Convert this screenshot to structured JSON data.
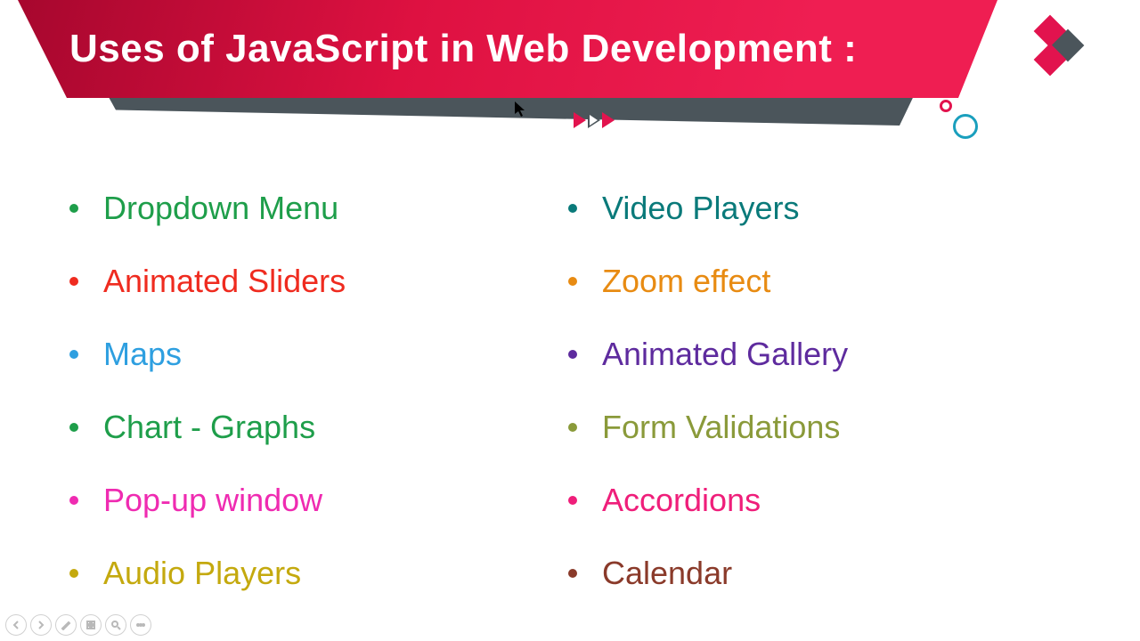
{
  "title": "Uses of JavaScript in Web Development :",
  "left_items": [
    {
      "label": "Dropdown Menu",
      "color": "#1e9e4a"
    },
    {
      "label": "Animated Sliders",
      "color": "#ef2b1f"
    },
    {
      "label": "Maps",
      "color": "#2e9fe0"
    },
    {
      "label": "Chart - Graphs",
      "color": "#1e9e4a"
    },
    {
      "label": "Pop-up window",
      "color": "#ef2bb1"
    },
    {
      "label": "Audio Players",
      "color": "#c4a90e"
    }
  ],
  "right_items": [
    {
      "label": "Video Players",
      "color": "#0a7a7a"
    },
    {
      "label": "Zoom effect",
      "color": "#e88b12"
    },
    {
      "label": "Animated Gallery",
      "color": "#5e2b9e"
    },
    {
      "label": "Form Validations",
      "color": "#8a9a3a"
    },
    {
      "label": "Accordions",
      "color": "#ef1e7a"
    },
    {
      "label": "Calendar",
      "color": "#8a3a2a"
    }
  ],
  "toolbar": {
    "prev": "previous-slide",
    "next": "next-slide",
    "pen": "pen-tool",
    "slides": "see-all-slides",
    "zoom": "zoom",
    "more": "more-options"
  }
}
